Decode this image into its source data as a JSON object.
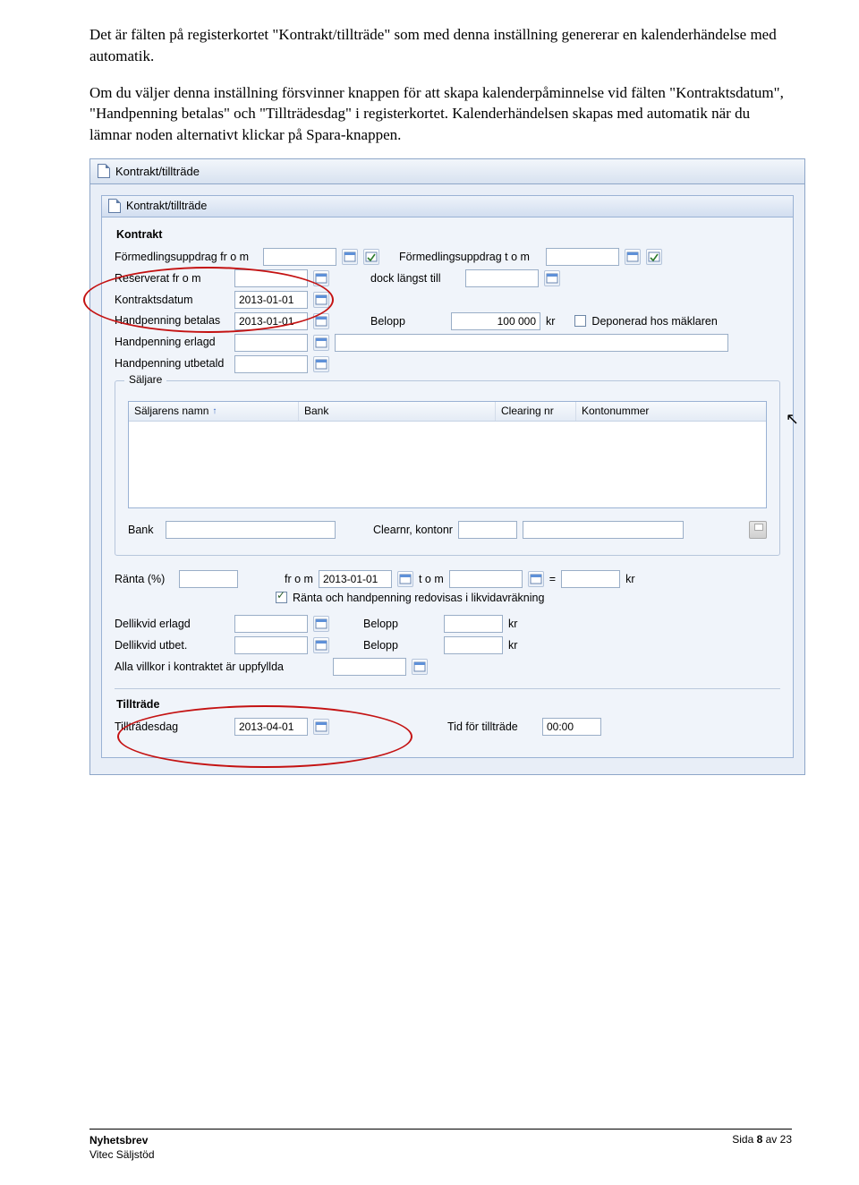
{
  "para1": "Det är fälten på registerkortet \"Kontrakt/tillträde\" som med denna inställning genererar en kalenderhändelse med automatik.",
  "para2": "Om du väljer denna inställning försvinner knappen för att skapa kalenderpåminnelse vid fälten \"Kontraktsdatum\", \"Handpenning betalas\" och \"Tillträdesdag\" i registerkortet. Kalenderhändelsen skapas med automatik när du lämnar noden alternativt klickar på Spara-knappen.",
  "window": {
    "title": "Kontrakt/tillträde"
  },
  "subtitle": "Kontrakt/tillträde",
  "sections": {
    "kontrakt": "Kontrakt",
    "saljare": "Säljare",
    "tilltrade": "Tillträde"
  },
  "labels": {
    "formedl_from": "Förmedlingsuppdrag fr o m",
    "formedl_to": "Förmedlingsuppdrag t o m",
    "reserverat": "Reserverat fr o m",
    "dock": "dock längst till",
    "kontraktsdatum": "Kontraktsdatum",
    "handp_betalas": "Handpenning betalas",
    "belopp": "Belopp",
    "kr": "kr",
    "deponerad": "Deponerad hos mäklaren",
    "handp_erlagd": "Handpenning erlagd",
    "handp_utbetald": "Handpenning utbetald",
    "saljarens_namn": "Säljarens namn",
    "bank": "Bank",
    "clearing": "Clearing nr",
    "kontonr": "Kontonummer",
    "clearnr_kontonr": "Clearnr, kontonr",
    "ranta": "Ränta (%)",
    "from_short": "fr o m",
    "tom_short": "t o m",
    "equals": "=",
    "ranta_note": "Ränta och handpenning redovisas i likvidavräkning",
    "dellikvid_erlagd": "Dellikvid erlagd",
    "dellikvid_utbet": "Dellikvid utbet.",
    "alla_villkor": "Alla villkor i kontraktet är uppfyllda",
    "tilltradesdag": "Tillträdesdag",
    "tid_for_tilltrade": "Tid för tillträde"
  },
  "values": {
    "kontraktsdatum": "2013-01-01",
    "handp_betalas": "2013-01-01",
    "belopp": "100 000",
    "ranta_from": "2013-01-01",
    "tilltradesdag": "2013-04-01",
    "tid_for_tilltrade": "00:00"
  },
  "footer": {
    "line1": "Nyhetsbrev",
    "line2": "Vitec Säljstöd",
    "page_prefix": "Sida ",
    "page_bold": "8",
    "page_suffix": " av 23"
  }
}
